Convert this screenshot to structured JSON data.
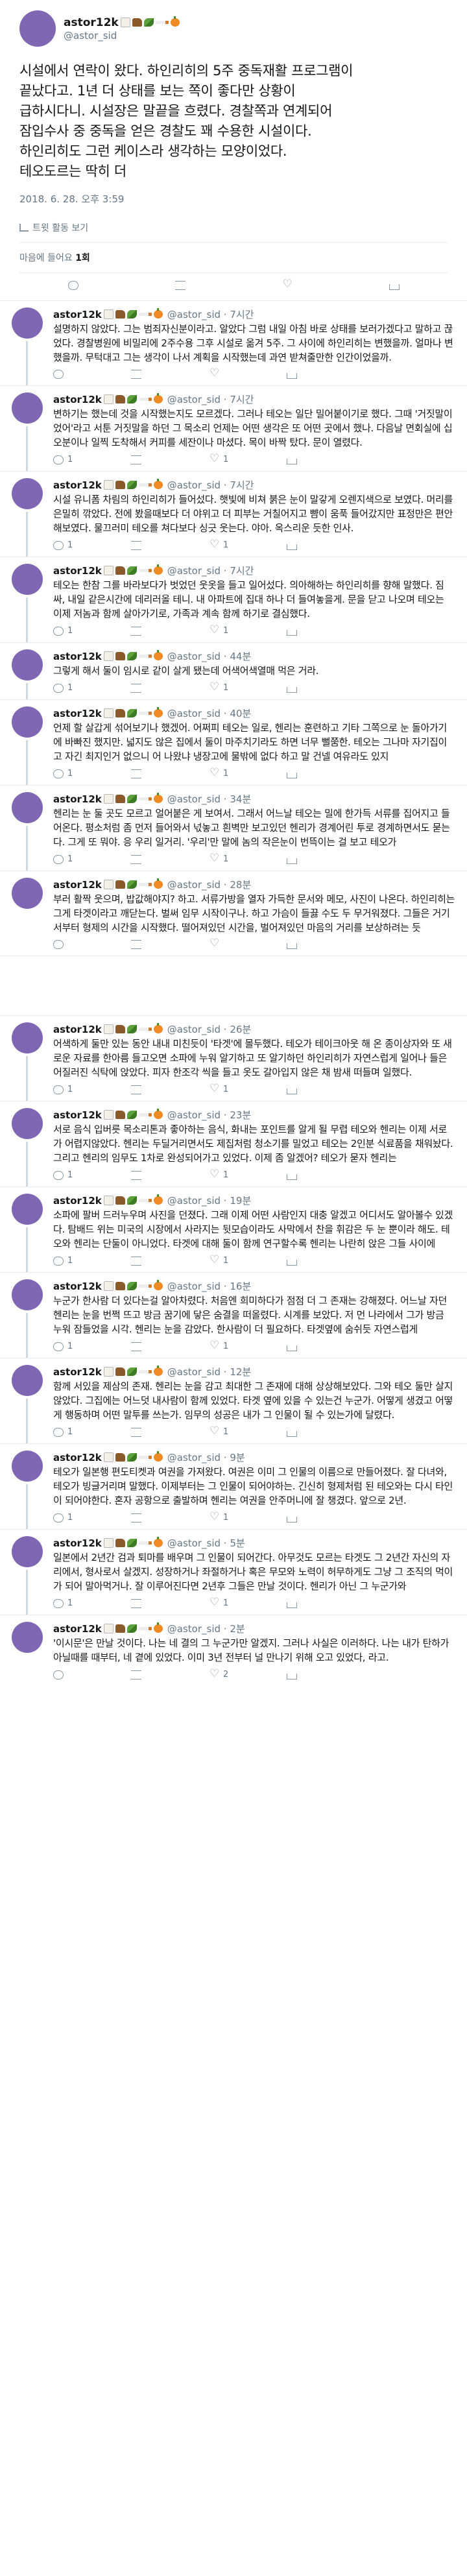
{
  "main": {
    "name": "astor12k",
    "handle": "@astor_sid",
    "text_lines": [
      "시설에서 연락이 왔다. 하인리히의 5주 중독재활 프로그램이",
      "끝났다고. 1년 더 상태를 보는 쪽이 좋다만 상황이",
      "급하시다니. 시설장은 말끝을 흐렸다. 경찰쪽과 연계되어",
      "잠입수사 중 중독을 얻은 경찰도 꽤 수용한 시설이다.",
      "하인리히도 그런 케이스라 생각하는 모양이었다.",
      "테오도르는 딱히 더"
    ],
    "timestamp": "2018. 6. 28. 오후 3:59",
    "activity_label": "트윗 활동 보기",
    "likes_label": "마음에 들어요",
    "likes_count": "1회"
  },
  "replies": [
    {
      "name": "astor12k",
      "meta": "@astor_sid · 7시간",
      "text": "설명하지 않았다. 그는 범죄자신분이라고. 알았다 그럼 내일 아침 바로 상태를 보러가겠다고 말하고 끊었다. 경찰병원에 비밀리에 2주수용 그후 시설로 옮겨 5주. 그 사이에 하인리히는 변했을까. 얼마나 변했을까. 무턱대고 그는 생각이 나서 계획을 시작했는데 과연 받쳐줄만한 인간이었을까.",
      "reply": "",
      "retweet": "",
      "like": ""
    },
    {
      "name": "astor12k",
      "meta": "@astor_sid · 7시간",
      "text": "변하기는 했는데 것을 시작했는지도 모르겠다. 그러나 테오는 일단 밀어붙이기로 했다. 그때 '거짓말이었어'라고 서툰 거짓말을 하던 그 목소리 언제는 어떤 생각은 또 어떤 곳에서 했나. 다음날 면회실에 십오분이나 일찍 도착해서 커피를 세잔이나 마셨다. 목이 바짝 탔다. 문이 열렸다.",
      "reply": "1",
      "retweet": "",
      "like": "1"
    },
    {
      "name": "astor12k",
      "meta": "@astor_sid · 7시간",
      "text": "시설 유니폼 차림의 하인리히가 들어섰다. 햇빛에 비쳐 붉은 눈이 말갛게 오렌지색으로 보였다. 머리를 은밀히 깎았다. 전에 봤을때보다 더 야위고 더 피부는 거칠어지고 뺨이 움푹 들어갔지만 표정만은 편안해보였다. 물끄러미 테오를 쳐다보다 싱긋 웃는다. 야아. 옥스리운 듯한 인사.",
      "reply": "1",
      "retweet": "",
      "like": "1"
    },
    {
      "name": "astor12k",
      "meta": "@astor_sid · 7시간",
      "text": "테오는 한참 그를 바라보다가 벗었던 웃옷을 들고 일어섰다. 의아해하는 하인리히를 향해 말했다. 짐싸, 내일 같은시간에 데리러올 테니. 내 아파트에 집대 하나 더 들여놓을게. 문을 닫고 나오며 테오는 이제 저놈과 함께 살아가기로, 가족과 계속 함께 하기로 결심했다.",
      "reply": "1",
      "retweet": "",
      "like": "1"
    },
    {
      "name": "astor12k",
      "meta": "@astor_sid · 44분",
      "text": "그렇게 해서 둘이 임시로 같이 살게 됐는데 어색어색열매 먹은 거라.",
      "reply": "1",
      "retweet": "",
      "like": "1"
    },
    {
      "name": "astor12k",
      "meta": "@astor_sid · 40분",
      "text": "언제 할 살갑게 섞어보기나 했겠어. 어쩌피 테오는 일로, 헨리는 훈련하고 기타 그쪽으로 눈 돌아가기에 바빠진 했지만. 넓지도 않은 집에서 둘이 마주치기라도 하면 너무 뻘쭘한. 테오는 그나마 자기집이고 자긴 최지인거 없으니 어 나왔냐 냉장고에 물밖에 없다 하고 말 건넬 여유라도 있지",
      "reply": "1",
      "retweet": "",
      "like": "1"
    },
    {
      "name": "astor12k",
      "meta": "@astor_sid · 34분",
      "text": "헨리는 눈 둘 곳도 모르고 얼어붙은 게 보여서. 그래서 어느날 테오는 밀에 한가득 서류를 집어지고 들어온다. 평소처럼 좀 먼저 들어와서 넋놓고 흰벽만 보고있던 헨리가 경계어린 투로 경계하면서도 묻는다. 그게 또 뭐야. 응 우리 일거리. '우리'만 말에 놈의 작은눈이 번뜩이는 걸 보고 테오가",
      "reply": "1",
      "retweet": "",
      "like": "1"
    },
    {
      "name": "astor12k",
      "meta": "@astor_sid · 28분",
      "text": "부러 활짝 웃으며, 밥값해야지? 하고. 서류가방을 열자 가득한 문서와 메모, 사진이 나온다. 하인리히는 그게 타겟이라고 깨닫는다. 벌써 임무 시작이구나. 하고 가슴이 들끓 수도 두 무거워졌다. 그들은 거기서부터 형제의 시간을 시작했다. 떨어져있던 시간을, 벌어져있던 마음의 거리를 보상하려는 듯",
      "reply": "",
      "retweet": "",
      "like": ""
    },
    {
      "name": "astor12k",
      "meta": "@astor_sid · 26분",
      "text": "어색하게 둘만 있는 동안 내내 미친듯이 '타겟'에 몰두했다. 테오가 테이크아웃 해 온 종이상자와 또 새로운 자료를 한아름 들고오면 소파에 누워 알기하고 또 알기하던 하인리히가 자연스럽게 일어나 들은 어질러진 식탁에 앉았다. 피자 한조각 씩을 들고 옷도 갈아입지 않은 채 밤새 떠들며 일했다.",
      "reply": "1",
      "retweet": "",
      "like": "1"
    },
    {
      "name": "astor12k",
      "meta": "@astor_sid · 23분",
      "text": "서로 음식 입버릇 목소리톤과 좋아하는 음식, 화내는 포인트를 알게 될 무렵 테오와 헨리는 이제 서로가 어렵지않았다. 헨리는 두딜거리면서도 제집처럼 청소기를 밀었고 테오는 2인분 식료품을 채워놨다. 그리고 헨리의 임무도 1차로 완성되어가고 있었다. 이제 좀 알겠어? 테오가 묻자 헨리는",
      "reply": "1",
      "retweet": "",
      "like": "1"
    },
    {
      "name": "astor12k",
      "meta": "@astor_sid · 19분",
      "text": "소파에 팔버 드러누우며 사진을 던졌다. 그래 이제 어떤 사람인지 대충 알겠고 어디서도 알아볼수 있겠다. 탐배드 위는 미국의 시장에서 사라지는 뒷모습이라도 사막에서 찬을 휘감은 두 눈 뿐이라 해도. 테오와 헨리는 단둘이 아니었다. 타겟에 대해 둘이 함께 연구할수록 헨리는 나란히 앉은 그들 사이에",
      "reply": "1",
      "retweet": "",
      "like": "1"
    },
    {
      "name": "astor12k",
      "meta": "@astor_sid · 16분",
      "text": "누군가 한사람 더 있다는걸 알아차렸다. 처음엔 희미하다가 점점 더 그 존재는 강해졌다. 어느날 자던 헨리는 눈을 번쩍 뜨고 방금 꿈기에 닿은 숨결을 떠올렸다. 시계를 보았다. 저 먼 나라에서 그가 방금 누워 잠들었을 시각. 헨리는 눈을 감았다. 한사람이 더 필요하다. 타겟옆에 숨쉬듯 자연스럽게",
      "reply": "1",
      "retweet": "",
      "like": "1"
    },
    {
      "name": "astor12k",
      "meta": "@astor_sid · 12분",
      "text": "함께 서있을 제삼의 존재. 헨리는 눈을 감고 최대한 그 존재에 대해 상상해보았다. 그와 테오 둘만 살지않았다. 그집에는 어느덧 내사람이 함께 있었다. 타겟 옆에 있을 수 있는건 누군가. 어떻게 생겼고 어떻게 행동하며 어떤 말투를 쓰는가. 임무의 성공은 내가 그 인물이 될 수 있는가에 달렸다.",
      "reply": "1",
      "retweet": "",
      "like": "1"
    },
    {
      "name": "astor12k",
      "meta": "@astor_sid · 9분",
      "text": "테오가 일본행 편도티켓과 여권을 가져왔다. 여권은 이미 그 인물의 이름으로 만들어졌다. 잘 다녀와, 테오가 빙글거리며 말했다. 이제부터는 그 인물이 되어야하는. 긴신히 형제처럼 된 테오와는 다시 타인이 되어야한다. 혼자 공항으로 출발하며 헨리는 여권을 안주머니에 잘 챙겼다. 앞으로 2년.",
      "reply": "1",
      "retweet": "",
      "like": "1"
    },
    {
      "name": "astor12k",
      "meta": "@astor_sid · 5분",
      "text": "일본에서 2년간 검과 퇴마를 배우며 그 인물이 되어간다. 아무것도 모르는 타겟도 그 2년간 자신의 자리에서, 형사로서 살겠지. 성장하거나 좌절하거나 혹은 무모와 노력이 허무하게도 그냥 그 조직의 먹이가 되어 말아먹거나. 잘 이루어진다면 2년후 그들은 만날 것이다. 헨리가 아닌 그 누군가와",
      "reply": "1",
      "retweet": "",
      "like": "1"
    },
    {
      "name": "astor12k",
      "meta": "@astor_sid · 2분",
      "text": "'이시문'은 만날 것이다. 나는 네 결의 그 누군가만 알겠지. 그러나 사실은 이러하다. 나는 내가 탄하가 아닐때를 때부터, 네 곁에 있었다. 이미 3년 전부터 널 만나기 위해 오고 있었다, 라고.",
      "reply": "",
      "retweet": "",
      "like": "2"
    }
  ]
}
